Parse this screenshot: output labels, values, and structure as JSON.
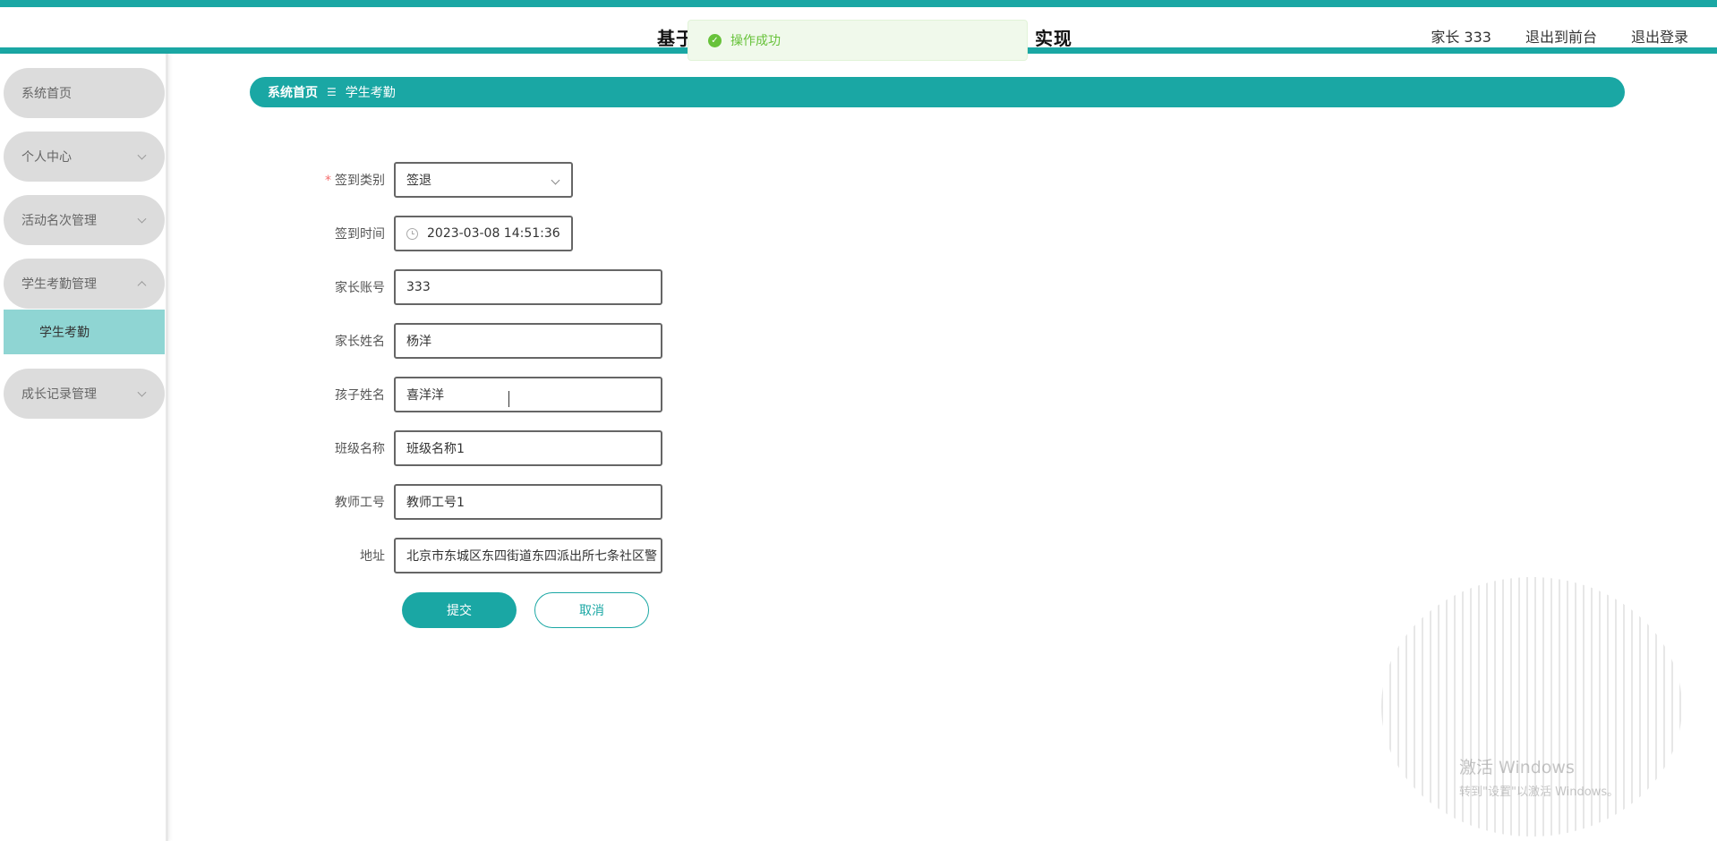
{
  "header": {
    "title": "基于 实现",
    "title_visible_left": "基于",
    "title_visible_right": "实现",
    "user": "家长 333",
    "link_front": "退出到前台",
    "link_logout": "退出登录"
  },
  "toast": {
    "message": "操作成功"
  },
  "sidebar": {
    "items": [
      {
        "label": "系统首页"
      },
      {
        "label": "个人中心"
      },
      {
        "label": "活动名次管理"
      },
      {
        "label": "学生考勤管理"
      },
      {
        "label": "成长记录管理"
      }
    ],
    "sub_active": "学生考勤"
  },
  "breadcrumb": {
    "home": "系统首页",
    "separator": "☰",
    "current": "学生考勤"
  },
  "form": {
    "sign_type": {
      "label": "签到类别",
      "value": "签退"
    },
    "sign_time": {
      "label": "签到时间",
      "value": "2023-03-08 14:51:36"
    },
    "parent_account": {
      "label": "家长账号",
      "value": "333"
    },
    "parent_name": {
      "label": "家长姓名",
      "value": "杨洋"
    },
    "child_name": {
      "label": "孩子姓名",
      "value": "喜洋洋"
    },
    "class_name": {
      "label": "班级名称",
      "value": "班级名称1"
    },
    "teacher_id": {
      "label": "教师工号",
      "value": "教师工号1"
    },
    "address": {
      "label": "地址",
      "value": "北京市东城区东四街道东四派出所七条社区警"
    }
  },
  "buttons": {
    "submit": "提交",
    "cancel": "取消"
  },
  "watermark": {
    "line1": "激活 Windows",
    "line2": "转到\"设置\"以激活 Windows。"
  },
  "colors": {
    "accent": "#1aa7a4",
    "sidebar_item": "#dcdcdc",
    "sidebar_active": "#8fd5d3",
    "toast_success": "#67c23a"
  }
}
